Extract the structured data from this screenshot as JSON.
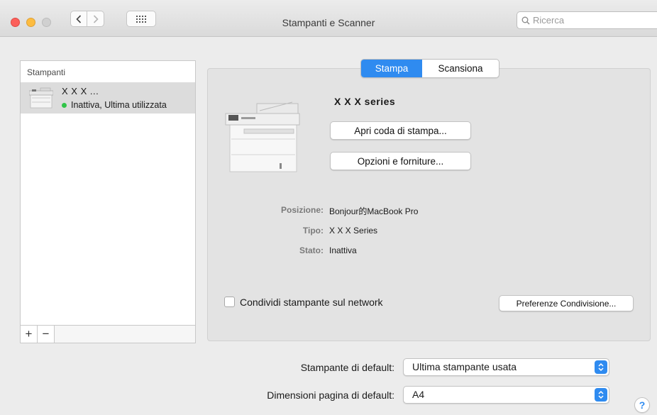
{
  "window": {
    "title": "Stampanti e Scanner"
  },
  "search": {
    "placeholder": "Ricerca"
  },
  "printer_list": {
    "header": "Stampanti",
    "items": [
      {
        "name": "X X X ...",
        "status": "Inattiva, Ultima utilizzata",
        "status_color": "#31c448"
      }
    ],
    "add_label": "+",
    "remove_label": "−"
  },
  "tabs": [
    {
      "label": "Stampa",
      "active": true
    },
    {
      "label": "Scansiona",
      "active": false
    }
  ],
  "device": {
    "name": "X X X  series",
    "open_queue_label": "Apri coda di stampa...",
    "options_label": "Opzioni e forniture..."
  },
  "info": {
    "location_label": "Posizione:",
    "location_value": "Bonjour的MacBook Pro",
    "type_label": "Tipo:",
    "type_value": "X X X  Series",
    "state_label": "Stato:",
    "state_value": "Inattiva"
  },
  "sharing": {
    "checkbox_label": "Condividi stampante sul network",
    "checked": false,
    "prefs_button": "Preferenze Condivisione..."
  },
  "defaults": {
    "printer_label": "Stampante di default:",
    "printer_value": "Ultima stampante usata",
    "paper_label": "Dimensioni pagina di default:",
    "paper_value": "A4"
  },
  "help": {
    "label": "?"
  },
  "colors": {
    "accent": "#2f8bf0"
  }
}
